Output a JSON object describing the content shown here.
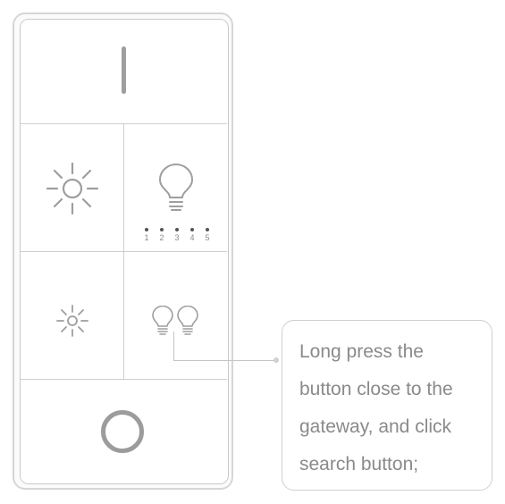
{
  "remote": {
    "buttons": {
      "power": {
        "icon": "power-bar-icon"
      },
      "brightness_up": {
        "icon": "sun-large-icon"
      },
      "bulb_single": {
        "icon": "light-bulb-icon",
        "scene_numbers": [
          "1",
          "2",
          "3",
          "4",
          "5"
        ]
      },
      "brightness_down": {
        "icon": "sun-small-icon"
      },
      "bulbs_pair": {
        "icon": "double-bulb-icon"
      },
      "circle": {
        "icon": "ring-icon"
      }
    }
  },
  "callout": {
    "lines": [
      "Long press the",
      "button close to the",
      "gateway, and click",
      "search button;"
    ]
  },
  "colors": {
    "icon_gray": "#9e9e9e",
    "text_gray": "#8a8a8a",
    "border_gray": "#cfcfcf"
  }
}
